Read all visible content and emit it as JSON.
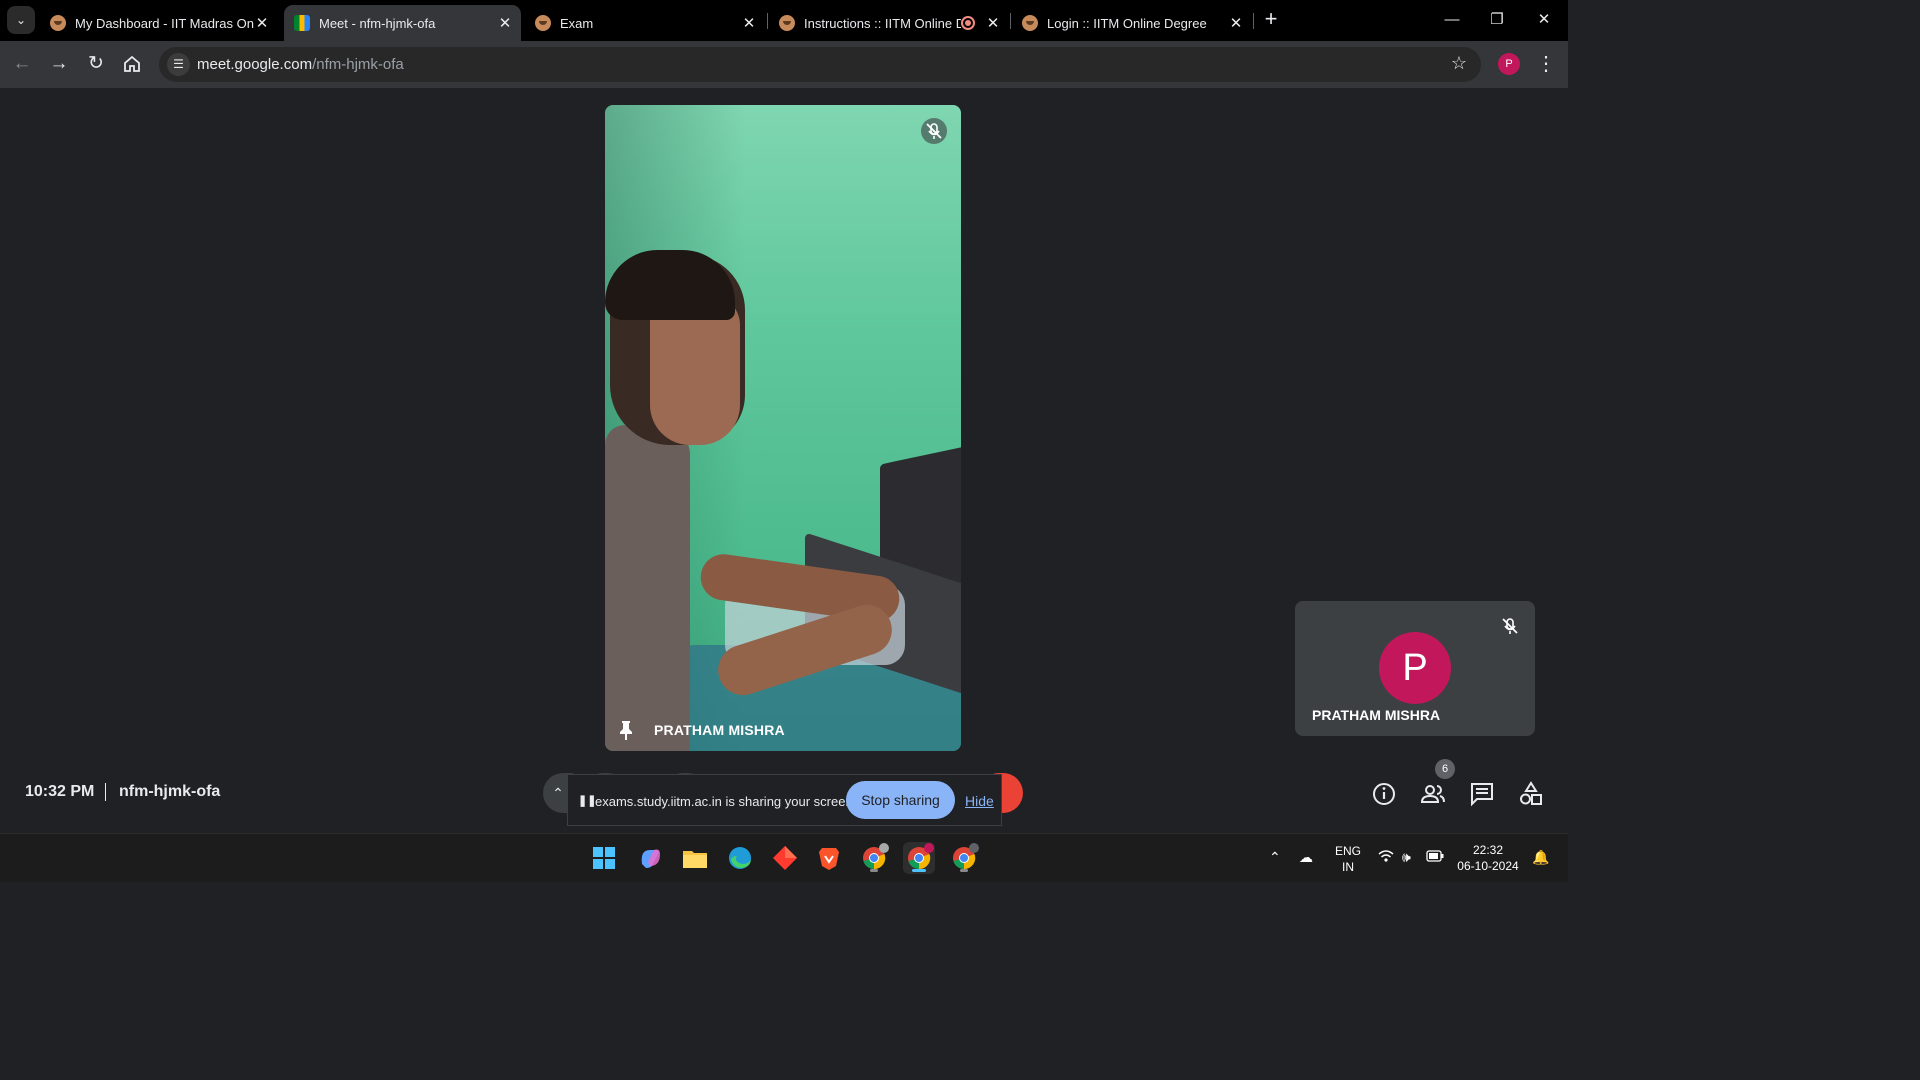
{
  "browser": {
    "tabs": [
      {
        "title": "My Dashboard - IIT Madras Onl",
        "favicon": "iitm-face-icon",
        "active": false
      },
      {
        "title": "Meet - nfm-hjmk-ofa",
        "favicon": "google-meet-icon",
        "active": true
      },
      {
        "title": "Exam",
        "favicon": "iitm-face-icon",
        "active": false
      },
      {
        "title": "Instructions :: IITM Online D",
        "favicon": "iitm-face-icon",
        "active": false,
        "recording": true
      },
      {
        "title": "Login :: IITM Online Degree",
        "favicon": "iitm-face-icon",
        "active": false
      }
    ],
    "url_host": "meet.google.com",
    "url_path": "/nfm-hjmk-ofa",
    "profile_initial": "P",
    "profile_color": "#c2185b"
  },
  "meet": {
    "main_tile": {
      "name": "PRATHAM MISHRA",
      "muted": true,
      "pinned": true
    },
    "self_tile": {
      "name": "PRATHAM MISHRA",
      "initial": "P",
      "avatar_color": "#c2185b",
      "muted": true
    },
    "time": "10:32 PM",
    "meeting_code": "nfm-hjmk-ofa",
    "participants_count": "6",
    "share_banner": {
      "text": "exams.study.iitm.ac.in is sharing your screen.",
      "stop_label": "Stop sharing",
      "hide_label": "Hide"
    },
    "accent": "#8ab4f8"
  },
  "taskbar": {
    "apps": [
      "windows-start-icon",
      "copilot-icon",
      "file-explorer-icon",
      "edge-icon",
      "ad-app-icon",
      "brave-icon",
      "chrome-icon",
      "chrome-profile-p-icon",
      "chrome-profile-p2-icon"
    ],
    "language_line1": "ENG",
    "language_line2": "IN",
    "time": "22:32",
    "date": "06-10-2024"
  }
}
